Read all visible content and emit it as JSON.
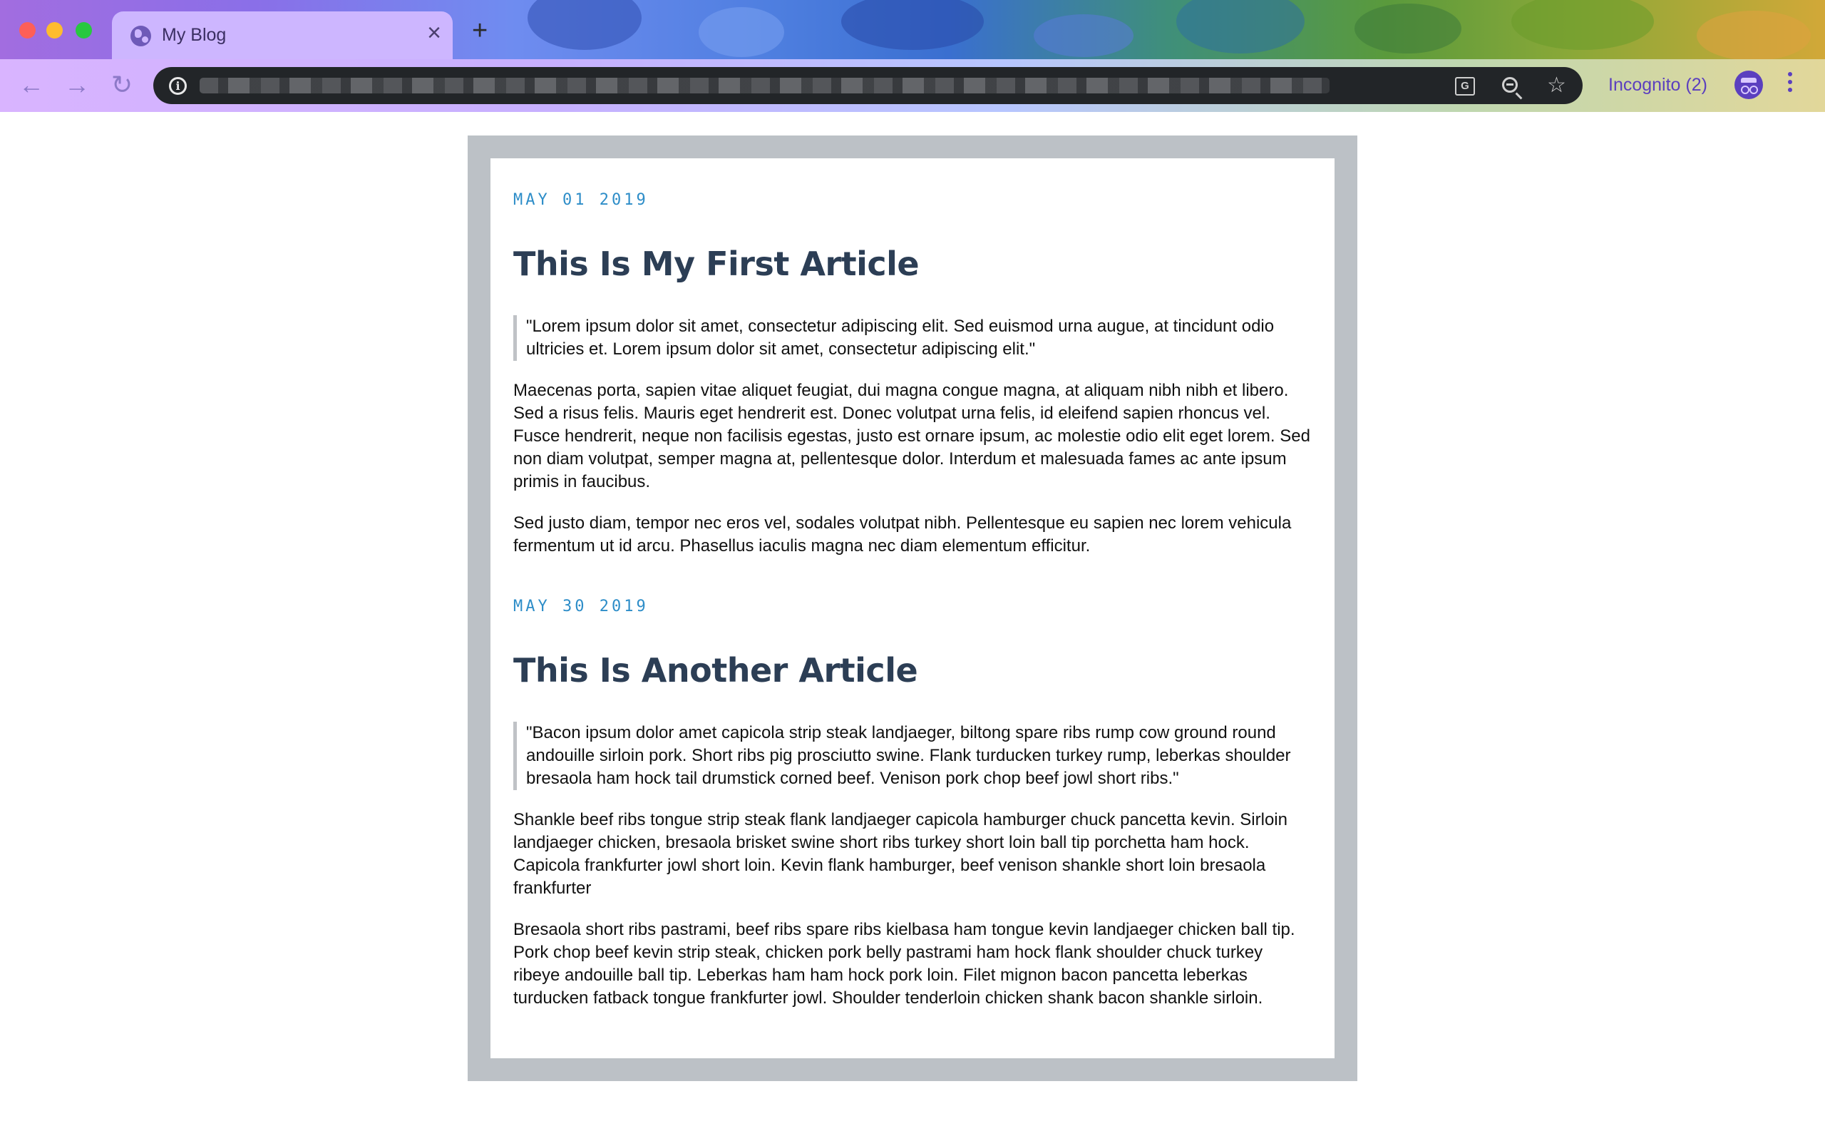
{
  "browser": {
    "tab_title": "My Blog",
    "tab_close": "×",
    "new_tab": "+",
    "info": "i",
    "translate": "G",
    "incognito_label": "Incognito (2)"
  },
  "articles": [
    {
      "date": "MAY 01 2019",
      "title": "This Is My First Article",
      "quote": "\"Lorem ipsum dolor sit amet, consectetur adipiscing elit. Sed euismod urna augue, at tincidunt odio ultricies et. Lorem ipsum dolor sit amet, consectetur adipiscing elit.\"",
      "paragraphs": [
        "Maecenas porta, sapien vitae aliquet feugiat, dui magna congue magna, at aliquam nibh nibh et libero. Sed a risus felis. Mauris eget hendrerit est. Donec volutpat urna felis, id eleifend sapien rhoncus vel. Fusce hendrerit, neque non facilisis egestas, justo est ornare ipsum, ac molestie odio elit eget lorem. Sed non diam volutpat, semper magna at, pellentesque dolor. Interdum et malesuada fames ac ante ipsum primis in faucibus.",
        "Sed justo diam, tempor nec eros vel, sodales volutpat nibh. Pellentesque eu sapien nec lorem vehicula fermentum ut id arcu. Phasellus iaculis magna nec diam elementum efficitur."
      ]
    },
    {
      "date": "MAY 30 2019",
      "title": "This Is Another Article",
      "quote": "\"Bacon ipsum dolor amet capicola strip steak landjaeger, biltong spare ribs rump cow ground round andouille sirloin pork. Short ribs pig prosciutto swine. Flank turducken turkey rump, leberkas shoulder bresaola ham hock tail drumstick corned beef. Venison pork chop beef jowl short ribs.\"",
      "paragraphs": [
        "Shankle beef ribs tongue strip steak flank landjaeger capicola hamburger chuck pancetta kevin. Sirloin landjaeger chicken, bresaola brisket swine short ribs turkey short loin ball tip porchetta ham hock. Capicola frankfurter jowl short loin. Kevin flank hamburger, beef venison shankle short loin bresaola frankfurter",
        "Bresaola short ribs pastrami, beef ribs spare ribs kielbasa ham tongue kevin landjaeger chicken ball tip. Pork chop beef kevin strip steak, chicken pork belly pastrami ham hock flank shoulder chuck turkey ribeye andouille ball tip. Leberkas ham ham hock pork loin. Filet mignon bacon pancetta leberkas turducken fatback tongue frankfurter jowl. Shoulder tenderloin chicken shank bacon shankle sirloin."
      ]
    }
  ],
  "icons": {
    "back": "back-arrow-icon",
    "forward": "forward-arrow-icon",
    "reload": "reload-icon",
    "info": "info-icon",
    "translate": "translate-icon",
    "zoom": "zoom-out-icon",
    "bookmark": "star-icon",
    "incognito": "incognito-icon",
    "menu": "kebab-menu-icon",
    "favicon": "globe-icon"
  },
  "colors": {
    "date_accent": "#2d8dc8",
    "title": "#2c3e55",
    "frame": "#bcc1c6",
    "incognito_accent": "#5b3fbf"
  }
}
